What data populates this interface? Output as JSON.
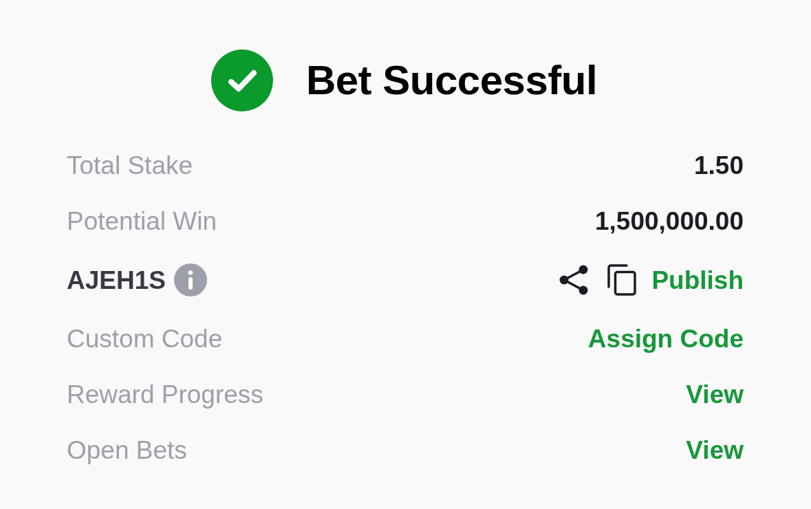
{
  "header": {
    "title": "Bet Successful"
  },
  "rows": [
    {
      "kind": "value",
      "label": "Total Stake",
      "value": "1.50"
    },
    {
      "kind": "value",
      "label": "Potential Win",
      "value": "1,500,000.00"
    },
    {
      "kind": "code",
      "code": "AJEH1S",
      "action": "Publish"
    },
    {
      "kind": "link",
      "label": "Custom Code",
      "action": "Assign Code"
    },
    {
      "kind": "link",
      "label": "Reward Progress",
      "action": "View"
    },
    {
      "kind": "link",
      "label": "Open Bets",
      "action": "View"
    }
  ]
}
